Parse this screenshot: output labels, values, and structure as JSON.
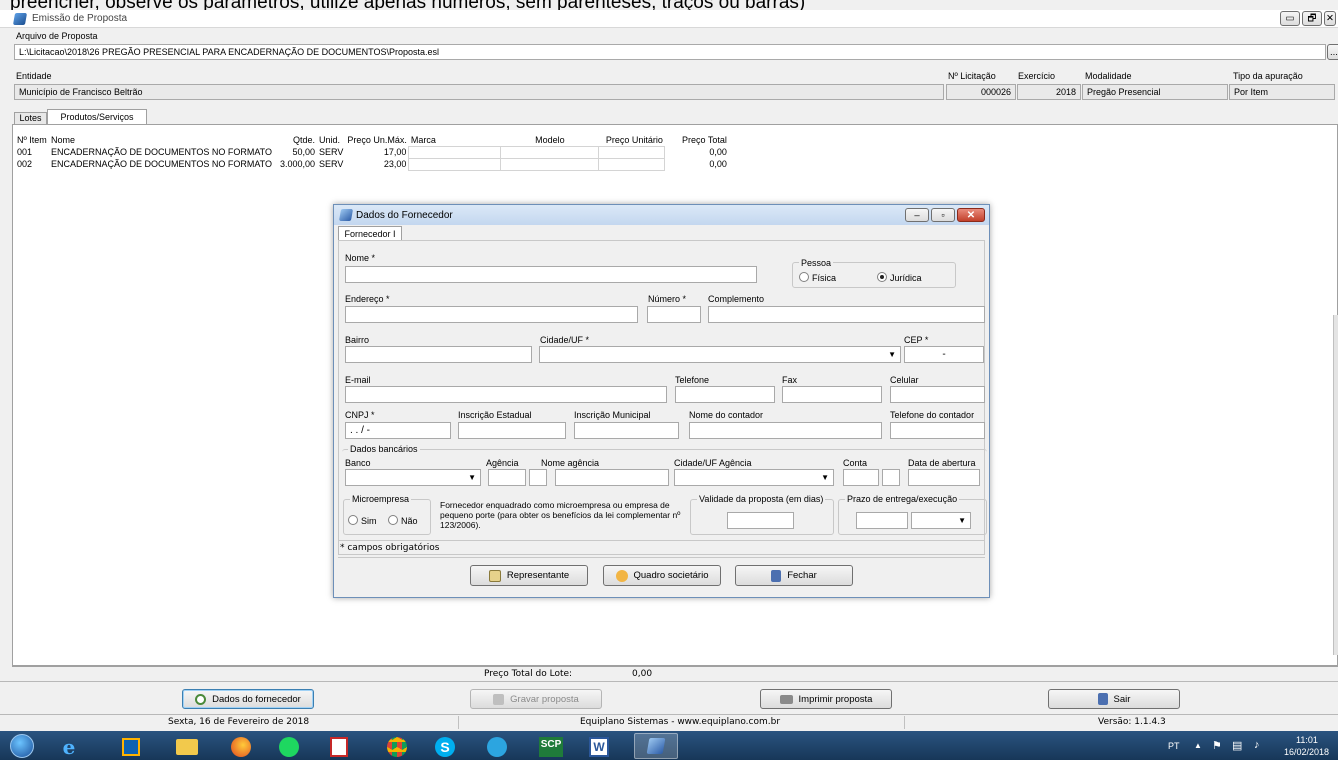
{
  "overlay_text": "preencher, observe os parâmetros, utilize apenas números, sem parênteses, traços ou barras)",
  "window": {
    "title": "Emissão de Proposta",
    "controls": [
      "▭",
      "🗗",
      "✕"
    ]
  },
  "file": {
    "label": "Arquivo de Proposta",
    "path": "L:\\Licitacao\\2018\\26 PREGÃO PRESENCIAL PARA ENCADERNAÇÃO DE DOCUMENTOS\\Proposta.esl",
    "browse": "..."
  },
  "header": {
    "entidade_label": "Entidade",
    "entidade_value": "Município de Francisco Beltrão",
    "licitacao_label": "Nº Licitação",
    "licitacao_value": "000026",
    "exercicio_label": "Exercício",
    "exercicio_value": "2018",
    "modalidade_label": "Modalidade",
    "modalidade_value": "Pregão Presencial",
    "apuracao_label": "Tipo da apuração",
    "apuracao_value": "Por Item"
  },
  "tabs": [
    "Lotes",
    "Produtos/Serviços"
  ],
  "table": {
    "headers": [
      "Nº Item",
      "Nome",
      "Qtde.",
      "Unid.",
      "Preço Un.Máx.",
      "Marca",
      "Modelo",
      "Preço Unitário",
      "Preço Total"
    ],
    "rows": [
      [
        "001",
        "ENCADERNAÇÃO DE DOCUMENTOS NO FORMATO",
        "50,00",
        "SERV",
        "17,00",
        "",
        "",
        "",
        "0,00"
      ],
      [
        "002",
        "ENCADERNAÇÃO DE DOCUMENTOS NO FORMATO",
        "3.000,00",
        "SERV",
        "23,00",
        "",
        "",
        "",
        "0,00"
      ]
    ]
  },
  "dialog": {
    "title": "Dados do Fornecedor",
    "tab": "Fornecedor I",
    "nome": "Nome *",
    "pessoa": "Pessoa",
    "fisica": "Física",
    "juridica": "Jurídica",
    "endereco": "Endereço *",
    "numero": "Número *",
    "complemento": "Complemento",
    "bairro": "Bairro",
    "cidade_uf": "Cidade/UF *",
    "cep": "CEP *",
    "cep_value": "-",
    "email": "E-mail",
    "telefone": "Telefone",
    "fax": "Fax",
    "celular": "Celular",
    "cnpj": "CNPJ *",
    "cnpj_value": ". . / -",
    "insc_estadual": "Inscrição Estadual",
    "insc_municipal": "Inscrição Municipal",
    "nome_contador": "Nome do contador",
    "tel_contador": "Telefone do contador",
    "dados_bancarios": "Dados bancários",
    "banco": "Banco",
    "agencia": "Agência",
    "nome_agencia": "Nome agência",
    "cidade_agencia": "Cidade/UF Agência",
    "conta": "Conta",
    "data_abertura": "Data de abertura",
    "microempresa": "Microempresa",
    "sim": "Sim",
    "nao": "Não",
    "micro_text": "Fornecedor enquadrado como microempresa ou empresa de pequeno porte (para obter os benefícios da lei complementar nº 123/2006).",
    "validade": "Validade da proposta (em dias)",
    "prazo": "Prazo de entrega/execução",
    "obrigatorios": "* campos obrigatórios",
    "btn_representante": "Representante",
    "btn_quadro": "Quadro societário",
    "btn_fechar": "Fechar"
  },
  "summary": {
    "label": "Preço Total do Lote:",
    "value": "0,00"
  },
  "bottom_buttons": {
    "fornecedor": "Dados do fornecedor",
    "gravar": "Gravar proposta",
    "imprimir": "Imprimir proposta",
    "sair": "Sair"
  },
  "statusbar": {
    "date": "Sexta, 16 de Fevereiro de 2018",
    "company": "Equiplano Sistemas - www.equiplano.com.br",
    "version": "Versão: 1.1.4.3"
  },
  "taskbar": {
    "lang": "PT",
    "time": "11:01",
    "date": "16/02/2018",
    "scp_label": "SCP"
  },
  "colors": {
    "accent_blue": "#2b5fb8",
    "taskbar": "#1c3f66",
    "dialog_title": "#c9def5"
  }
}
